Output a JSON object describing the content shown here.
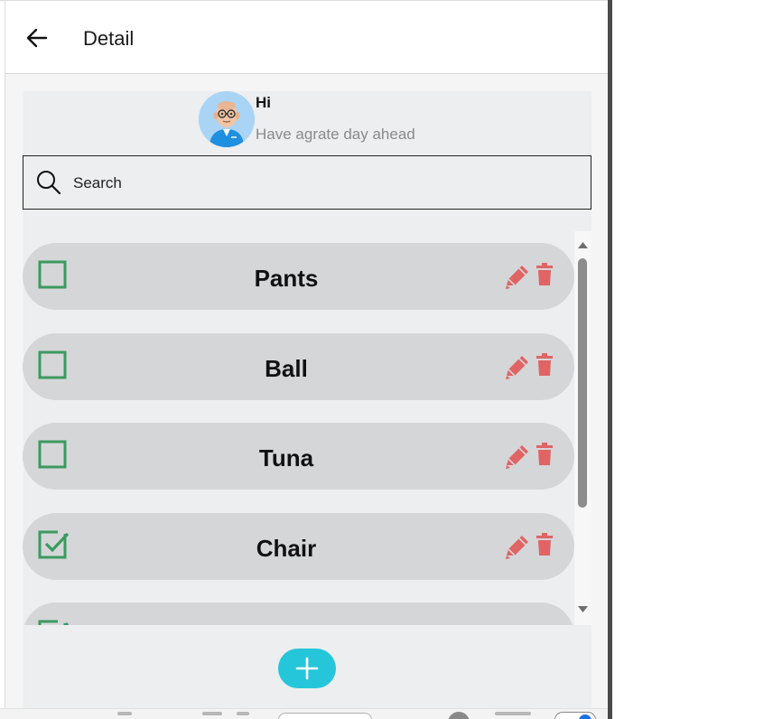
{
  "appbar": {
    "title": "Detail",
    "back_icon": "arrow-left-icon"
  },
  "header": {
    "greeting": "Hi",
    "subtitle": "Have agrate day ahead",
    "avatar_icon": "avatar-icon"
  },
  "search": {
    "placeholder": "Search",
    "icon": "search-icon"
  },
  "todos": [
    {
      "label": "Pants",
      "checked": false
    },
    {
      "label": "Ball",
      "checked": false
    },
    {
      "label": "Tuna",
      "checked": false
    },
    {
      "label": "Chair",
      "checked": true
    },
    {
      "label": "",
      "checked": true
    }
  ],
  "actions": {
    "edit_icon": "pencil-icon",
    "delete_icon": "trash-icon",
    "add_icon": "plus-icon"
  },
  "colors": {
    "checkbox": "#3c9a5f",
    "action": "#e06464",
    "fab": "#26c6da",
    "item_bg": "#d5d6d8",
    "panel_bg": "#eceeef"
  }
}
